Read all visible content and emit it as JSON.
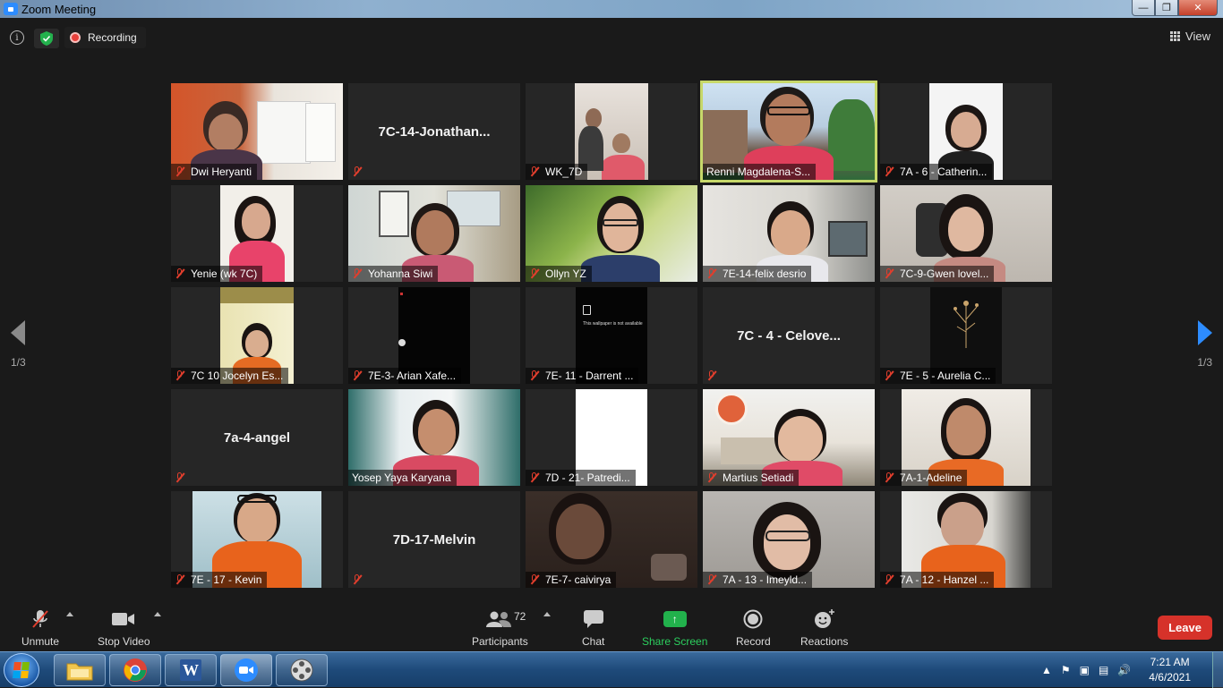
{
  "window": {
    "title": "Zoom Meeting"
  },
  "topbar": {
    "recording_label": "Recording",
    "view_label": "View"
  },
  "pager": {
    "left": "1/3",
    "right": "1/3"
  },
  "tiles": [
    {
      "name": "Dwi Heryanti",
      "muted": true,
      "video": true
    },
    {
      "name": "7C-14-Jonathan...",
      "muted": true,
      "video": false,
      "center": "7C-14-Jonathan..."
    },
    {
      "name": "WK_7D",
      "muted": true,
      "video": true
    },
    {
      "name": "Renni Magdalena-S...",
      "muted": false,
      "video": true,
      "active": true
    },
    {
      "name": "7A - 6 - Catherin...",
      "muted": true,
      "video": true
    },
    {
      "name": "Yenie (wk 7C)",
      "muted": true,
      "video": true
    },
    {
      "name": "Yohanna Siwi",
      "muted": true,
      "video": true
    },
    {
      "name": "Ollyn YZ",
      "muted": true,
      "video": true
    },
    {
      "name": "7E-14-felix desrio",
      "muted": true,
      "video": true
    },
    {
      "name": "7C-9-Gwen lovel...",
      "muted": true,
      "video": true
    },
    {
      "name": "7C 10 Jocelyn Es...",
      "muted": true,
      "video": true
    },
    {
      "name": "7E-3- Arian Xafe...",
      "muted": true,
      "video": true
    },
    {
      "name": "7E- 11 - Darrent ...",
      "muted": true,
      "video": true
    },
    {
      "name": "7C - 4 - Celove...",
      "muted": true,
      "video": false,
      "center": "7C - 4 - Celove..."
    },
    {
      "name": "7E - 5 - Aurelia C...",
      "muted": true,
      "video": true
    },
    {
      "name": "7a-4-angel",
      "muted": true,
      "video": false,
      "center": "7a-4-angel"
    },
    {
      "name": "Yosep Yaya Karyana",
      "muted": false,
      "video": true
    },
    {
      "name": "7D - 21- Patredi...",
      "muted": true,
      "video": true
    },
    {
      "name": "Martius Setiadi",
      "muted": true,
      "video": true
    },
    {
      "name": "7A-1-Adeline",
      "muted": true,
      "video": true
    },
    {
      "name": "7E - 17 - Kevin",
      "muted": true,
      "video": true
    },
    {
      "name": "7D-17-Melvin",
      "muted": true,
      "video": false,
      "center": "7D-17-Melvin"
    },
    {
      "name": "7E-7- caivirya",
      "muted": true,
      "video": true
    },
    {
      "name": "7A - 13 - Imeyld...",
      "muted": true,
      "video": true
    },
    {
      "name": "7A - 12 - Hanzel ...",
      "muted": true,
      "video": true
    }
  ],
  "darrent_overlay": "This wallpaper is not available",
  "toolbar": {
    "unmute": "Unmute",
    "stop_video": "Stop Video",
    "participants": "Participants",
    "participants_count": "72",
    "chat": "Chat",
    "share_screen": "Share Screen",
    "record": "Record",
    "reactions": "Reactions",
    "leave": "Leave"
  },
  "taskbar": {
    "time": "7:21 AM",
    "date": "4/6/2021"
  },
  "colors": {
    "accent": "#2d8cff",
    "leave": "#d6322a",
    "share": "#22b14c",
    "active_speaker": "#c7d86a",
    "muted_icon": "#e03e2d"
  }
}
